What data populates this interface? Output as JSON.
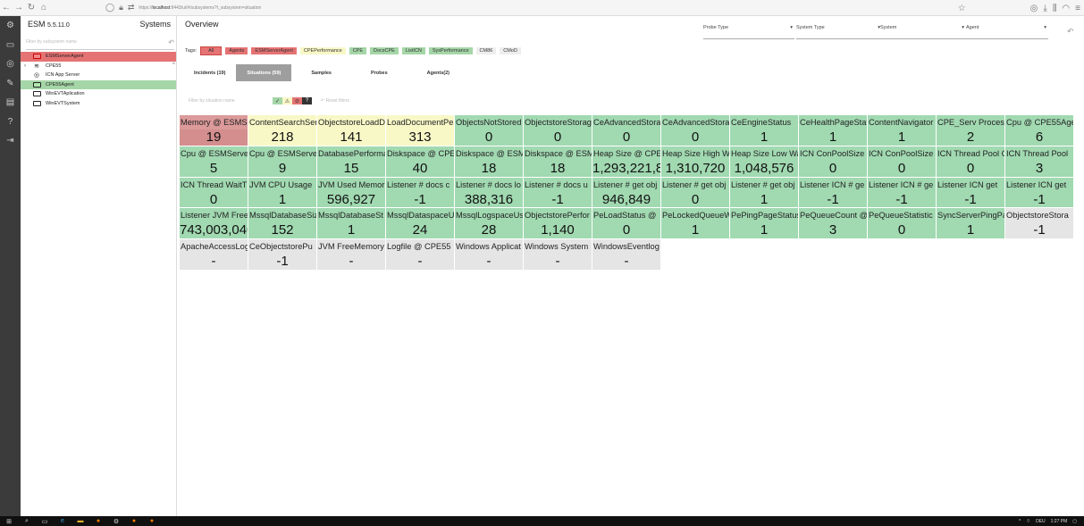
{
  "browser": {
    "url_prefix": "https://",
    "url_host": "localhost",
    "url_rest": ":8443/ui/#/subsystems?t_subsystem=situation"
  },
  "app": {
    "title": "ESM",
    "version": "5.5.11.0",
    "section": "Systems"
  },
  "sidebar": {
    "filter_placeholder": "Filter by subsystem name",
    "items": [
      {
        "label": "ESMServerAgent",
        "status": "red"
      },
      {
        "label": "CPE55",
        "status": "none"
      },
      {
        "label": "ICN App Server",
        "status": "none"
      },
      {
        "label": "CPE55Agent",
        "status": "green"
      },
      {
        "label": "WinEVTAplication",
        "status": "none"
      },
      {
        "label": "WinEVTSystem",
        "status": "none"
      }
    ]
  },
  "main": {
    "title": "Overview",
    "dropdowns": [
      "Probe Type",
      "System Type",
      "System",
      "Agent"
    ],
    "tags_label": "Tags:",
    "tags": [
      {
        "label": "All",
        "color": "#e57373"
      },
      {
        "label": "Agents",
        "color": "#e57373"
      },
      {
        "label": "ESMServerAgent",
        "color": "#e57373"
      },
      {
        "label": "CPEPerformance",
        "color": "#f8f8c7"
      },
      {
        "label": "CPE",
        "color": "#a5d6a7"
      },
      {
        "label": "DocsCPE",
        "color": "#a5d6a7"
      },
      {
        "label": "ListICN",
        "color": "#a5d6a7"
      },
      {
        "label": "SysPerformance",
        "color": "#a5d6a7"
      },
      {
        "label": "CM86",
        "color": "#eeeeee"
      },
      {
        "label": "CMoD",
        "color": "#eeeeee"
      }
    ],
    "tabs": [
      "Incidents (19)",
      "Situations (59)",
      "Samples",
      "Probes",
      "Agents(2)"
    ],
    "active_tab": 1,
    "filter_placeholder": "Filter by situation name",
    "reset_label": "Reset filters",
    "cells": [
      {
        "name": "Memory @ ESMS",
        "value": "19",
        "status": "red"
      },
      {
        "name": "ContentSearchSer",
        "value": "218",
        "status": "yellow"
      },
      {
        "name": "ObjectstoreLoadD",
        "value": "141",
        "status": "yellow"
      },
      {
        "name": "LoadDocumentPe",
        "value": "313",
        "status": "yellow"
      },
      {
        "name": "ObjectsNotStored",
        "value": "0",
        "status": "green"
      },
      {
        "name": "ObjectstoreStorag",
        "value": "0",
        "status": "green"
      },
      {
        "name": "CeAdvancedStora",
        "value": "0",
        "status": "green"
      },
      {
        "name": "CeAdvancedStora",
        "value": "0",
        "status": "green"
      },
      {
        "name": "CeEngineStatus",
        "value": "1",
        "status": "green"
      },
      {
        "name": "CeHealthPageStat",
        "value": "1",
        "status": "green"
      },
      {
        "name": "ContentNavigator",
        "value": "1",
        "status": "green"
      },
      {
        "name": "CPE_Serv Process",
        "value": "2",
        "status": "green"
      },
      {
        "name": "Cpu @ CPE55Age",
        "value": "6",
        "status": "green"
      },
      {
        "name": "Cpu @ ESMServer",
        "value": "5",
        "status": "green"
      },
      {
        "name": "Cpu @ ESMServer",
        "value": "9",
        "status": "green"
      },
      {
        "name": "DatabasePerforma",
        "value": "15",
        "status": "green"
      },
      {
        "name": "Diskspace @ CPE5",
        "value": "40",
        "status": "green"
      },
      {
        "name": "Diskspace @ ESMS",
        "value": "18",
        "status": "green"
      },
      {
        "name": "Diskspace @ ESMS",
        "value": "18",
        "status": "green"
      },
      {
        "name": "Heap Size @ CPE55CP",
        "value": "1,293,221,888",
        "status": "green"
      },
      {
        "name": "Heap Size High Wa",
        "value": "1,310,720",
        "status": "green"
      },
      {
        "name": "Heap Size Low Wat",
        "value": "1,048,576",
        "status": "green"
      },
      {
        "name": "ICN ConPoolSize",
        "value": "0",
        "status": "green"
      },
      {
        "name": "ICN ConPoolSize Fr",
        "value": "0",
        "status": "green"
      },
      {
        "name": "ICN Thread Pool C",
        "value": "0",
        "status": "green"
      },
      {
        "name": "ICN Thread Pool",
        "value": "3",
        "status": "green"
      },
      {
        "name": "ICN Thread WaitT",
        "value": "0",
        "status": "green"
      },
      {
        "name": "JVM CPU Usage",
        "value": "1",
        "status": "green"
      },
      {
        "name": "JVM Used Memor",
        "value": "596,927",
        "status": "green"
      },
      {
        "name": "Listener # docs c",
        "value": "-1",
        "status": "green"
      },
      {
        "name": "Listener # docs lo",
        "value": "388,316",
        "status": "green"
      },
      {
        "name": "Listener # docs u",
        "value": "-1",
        "status": "green"
      },
      {
        "name": "Listener # get obj",
        "value": "946,849",
        "status": "green"
      },
      {
        "name": "Listener # get obj",
        "value": "0",
        "status": "green"
      },
      {
        "name": "Listener # get obj",
        "value": "1",
        "status": "green"
      },
      {
        "name": "Listener ICN # ge",
        "value": "-1",
        "status": "green"
      },
      {
        "name": "Listener ICN # ge",
        "value": "-1",
        "status": "green"
      },
      {
        "name": "Listener ICN get",
        "value": "-1",
        "status": "green"
      },
      {
        "name": "Listener ICN get",
        "value": "-1",
        "status": "green"
      },
      {
        "name": "Listener JVM Free",
        "value": "743,003,040",
        "status": "green"
      },
      {
        "name": "MssqlDatabaseSiz",
        "value": "152",
        "status": "green"
      },
      {
        "name": "MssqlDatabaseSt",
        "value": "1",
        "status": "green"
      },
      {
        "name": "MssqlDataspaceU",
        "value": "24",
        "status": "green"
      },
      {
        "name": "MssqlLogspaceUs",
        "value": "28",
        "status": "green"
      },
      {
        "name": "ObjectstorePerfor",
        "value": "1,140",
        "status": "green"
      },
      {
        "name": "PeLoadStatus @",
        "value": "0",
        "status": "green"
      },
      {
        "name": "PeLockedQueueW",
        "value": "1",
        "status": "green"
      },
      {
        "name": "PePingPageStatus",
        "value": "1",
        "status": "green"
      },
      {
        "name": "PeQueueCount @",
        "value": "3",
        "status": "green"
      },
      {
        "name": "PeQueueStatistic",
        "value": "0",
        "status": "green"
      },
      {
        "name": "SyncServerPingPa",
        "value": "1",
        "status": "green"
      },
      {
        "name": "ObjectstoreStora",
        "value": "-1",
        "status": "gray"
      },
      {
        "name": "ApacheAccessLog",
        "value": "-",
        "status": "gray"
      },
      {
        "name": "CeObjectstorePu",
        "value": "-1",
        "status": "gray"
      },
      {
        "name": "JVM FreeMemory",
        "value": "-",
        "status": "gray"
      },
      {
        "name": "Logfile @ CPE55",
        "value": "-",
        "status": "gray"
      },
      {
        "name": "Windows Applicat",
        "value": "-",
        "status": "gray"
      },
      {
        "name": "Windows System",
        "value": "-",
        "status": "gray"
      },
      {
        "name": "WindowsEventlog",
        "value": "-",
        "status": "gray"
      }
    ]
  },
  "taskbar": {
    "time": "1:27 PM",
    "lang": "DEU"
  },
  "icons": {
    "rail": [
      "settings-icon",
      "monitor-icon",
      "target-icon",
      "pen-icon",
      "chart-icon",
      "help-icon",
      "logout-icon"
    ]
  }
}
